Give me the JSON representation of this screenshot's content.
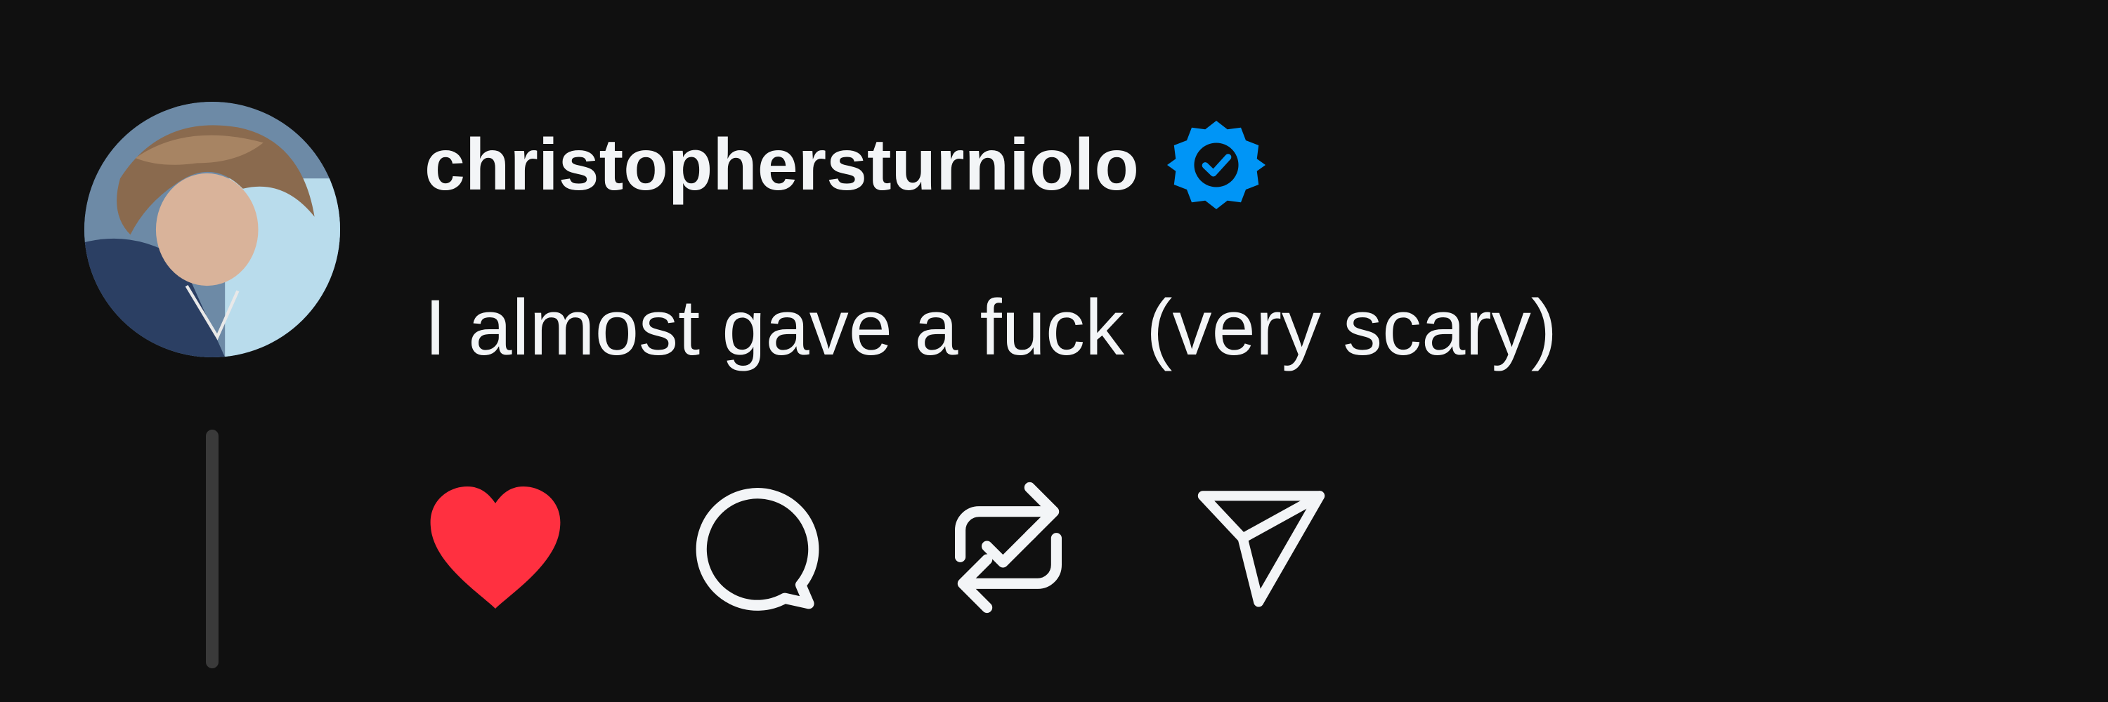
{
  "post": {
    "username": "christophersturniolo",
    "verified": true,
    "text": "I almost gave a fuck (very scary)",
    "liked": true,
    "reposted": true
  },
  "icons": {
    "avatar": "profile-photo",
    "verified": "verified-badge-icon",
    "like": "heart-icon",
    "reply": "comment-bubble-icon",
    "repost": "repost-check-icon",
    "share": "send-paper-plane-icon"
  },
  "colors": {
    "background": "#101010",
    "text": "#f3f5f7",
    "verified": "#0095f6",
    "like": "#ff3040",
    "thread_line": "#3a3a3a"
  }
}
